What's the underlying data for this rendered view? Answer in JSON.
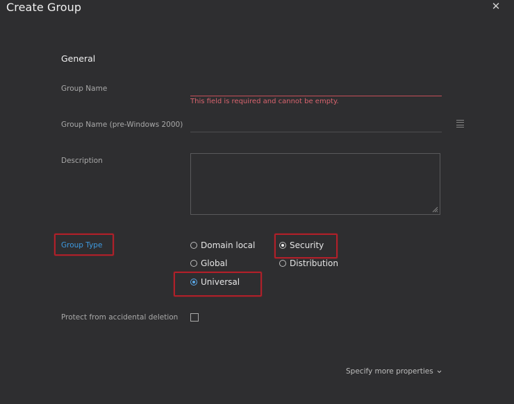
{
  "dialog": {
    "title": "Create Group",
    "close_glyph": "✕"
  },
  "form": {
    "section_title": "General",
    "group_name": {
      "label": "Group Name",
      "value": "",
      "error": "This field is required and cannot be empty."
    },
    "group_name_pre2000": {
      "label": "Group Name (pre-Windows 2000)",
      "value": "",
      "side_icon": "list-icon"
    },
    "description": {
      "label": "Description",
      "value": ""
    },
    "group_type": {
      "label": "Group Type",
      "scope_options": [
        "Domain local",
        "Global",
        "Universal"
      ],
      "scope_selected": "Universal",
      "type_options": [
        "Security",
        "Distribution"
      ],
      "type_selected": "Security"
    },
    "protect": {
      "label": "Protect from accidental deletion",
      "checked": false
    },
    "more_properties": "Specify more properties"
  },
  "colors": {
    "background": "#2e2e30",
    "highlight": "#b0202a",
    "accent_blue": "#3e9ae0",
    "error": "#d9646e"
  }
}
